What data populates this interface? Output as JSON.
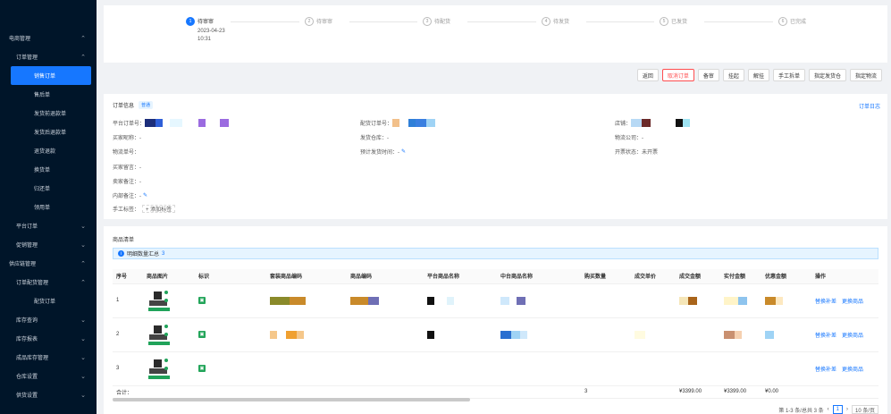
{
  "sidebar": {
    "items": [
      {
        "label": "电商管理",
        "level": 0,
        "chevron": "^"
      },
      {
        "label": "订单管理",
        "level": 1,
        "chevron": "^"
      },
      {
        "label": "销售订单",
        "level": 2,
        "active": true
      },
      {
        "label": "售后单",
        "level": 2
      },
      {
        "label": "发货前退款单",
        "level": 2
      },
      {
        "label": "发货后退款单",
        "level": 2
      },
      {
        "label": "退货退款",
        "level": 2
      },
      {
        "label": "换货单",
        "level": 2
      },
      {
        "label": "归还单",
        "level": 2
      },
      {
        "label": "领用单",
        "level": 2
      },
      {
        "label": "平台订单",
        "level": 1,
        "chevron": "v"
      },
      {
        "label": "促销管理",
        "level": 1,
        "chevron": "v"
      },
      {
        "label": "供应链管理",
        "level": 0,
        "chevron": "^"
      },
      {
        "label": "订单配货管理",
        "level": 1,
        "chevron": "^"
      },
      {
        "label": "配货订单",
        "level": 2
      },
      {
        "label": "库存查询",
        "level": 1,
        "chevron": "v"
      },
      {
        "label": "库存报表",
        "level": 1,
        "chevron": "v"
      },
      {
        "label": "成品库存管理",
        "level": 1,
        "chevron": "v"
      },
      {
        "label": "仓库设置",
        "level": 1,
        "chevron": "v"
      },
      {
        "label": "供货设置",
        "level": 1,
        "chevron": "v"
      }
    ]
  },
  "steps": [
    {
      "num": "1",
      "title": "待审审",
      "date": "2023-04-23",
      "time": "10:31",
      "current": true
    },
    {
      "num": "2",
      "title": "待审审"
    },
    {
      "num": "3",
      "title": "待配货"
    },
    {
      "num": "4",
      "title": "待发货"
    },
    {
      "num": "5",
      "title": "已发货"
    },
    {
      "num": "6",
      "title": "已完成"
    }
  ],
  "toolbar": [
    "返回",
    "取消订单",
    "备审",
    "挂起",
    "解挂",
    "手工拆单",
    "指定发货仓",
    "指定物流"
  ],
  "info": {
    "title": "订单信息",
    "tag": "普通",
    "log_link": "订单日志",
    "platform_order": "平台订单号：",
    "dist_order": "配货订单号：",
    "shop": "店铺：",
    "buyer": "买家昵称：-",
    "warehouse": "发货仓库：-",
    "logistics": "物流公司：-",
    "tracking": "物流单号：",
    "eta": "预计发货时间：-",
    "invoice": "开票状态：未开票",
    "buyer_note": "买家留言：-",
    "seller_note": "卖家备注：-",
    "internal_note": "内部备注：-",
    "manual_tag": "手工标签：",
    "add_tag": "+ 添加标签"
  },
  "goods": {
    "title": "商品清单",
    "summary_label": "明细数量汇总",
    "summary_count": "3",
    "columns": [
      "序号",
      "商品图片",
      "标识",
      "套装商品编码",
      "商品编码",
      "平台商品名称",
      "中台商品名称",
      "购买数量",
      "成交单价",
      "成交金额",
      "实付金额",
      "优惠金额",
      "操作"
    ],
    "rows": [
      {
        "idx": "1",
        "op1": "替换补差",
        "op2": "更换商品"
      },
      {
        "idx": "2",
        "op1": "替换补差",
        "op2": "更换商品"
      },
      {
        "idx": "3",
        "op1": "替换补差",
        "op2": "更换商品"
      }
    ],
    "total": {
      "label": "合计：",
      "qty": "3",
      "deal": "¥3399.00",
      "paid": "¥3399.00",
      "discount": "¥0.00"
    },
    "pager": {
      "text": "第 1-3 条/总共 3 条",
      "page": "1",
      "size": "10 条/页"
    }
  },
  "colors": {
    "primary": "#1677ff",
    "sidebar": "#001529",
    "danger": "#ff4d4f",
    "mark": "#23a55a"
  }
}
